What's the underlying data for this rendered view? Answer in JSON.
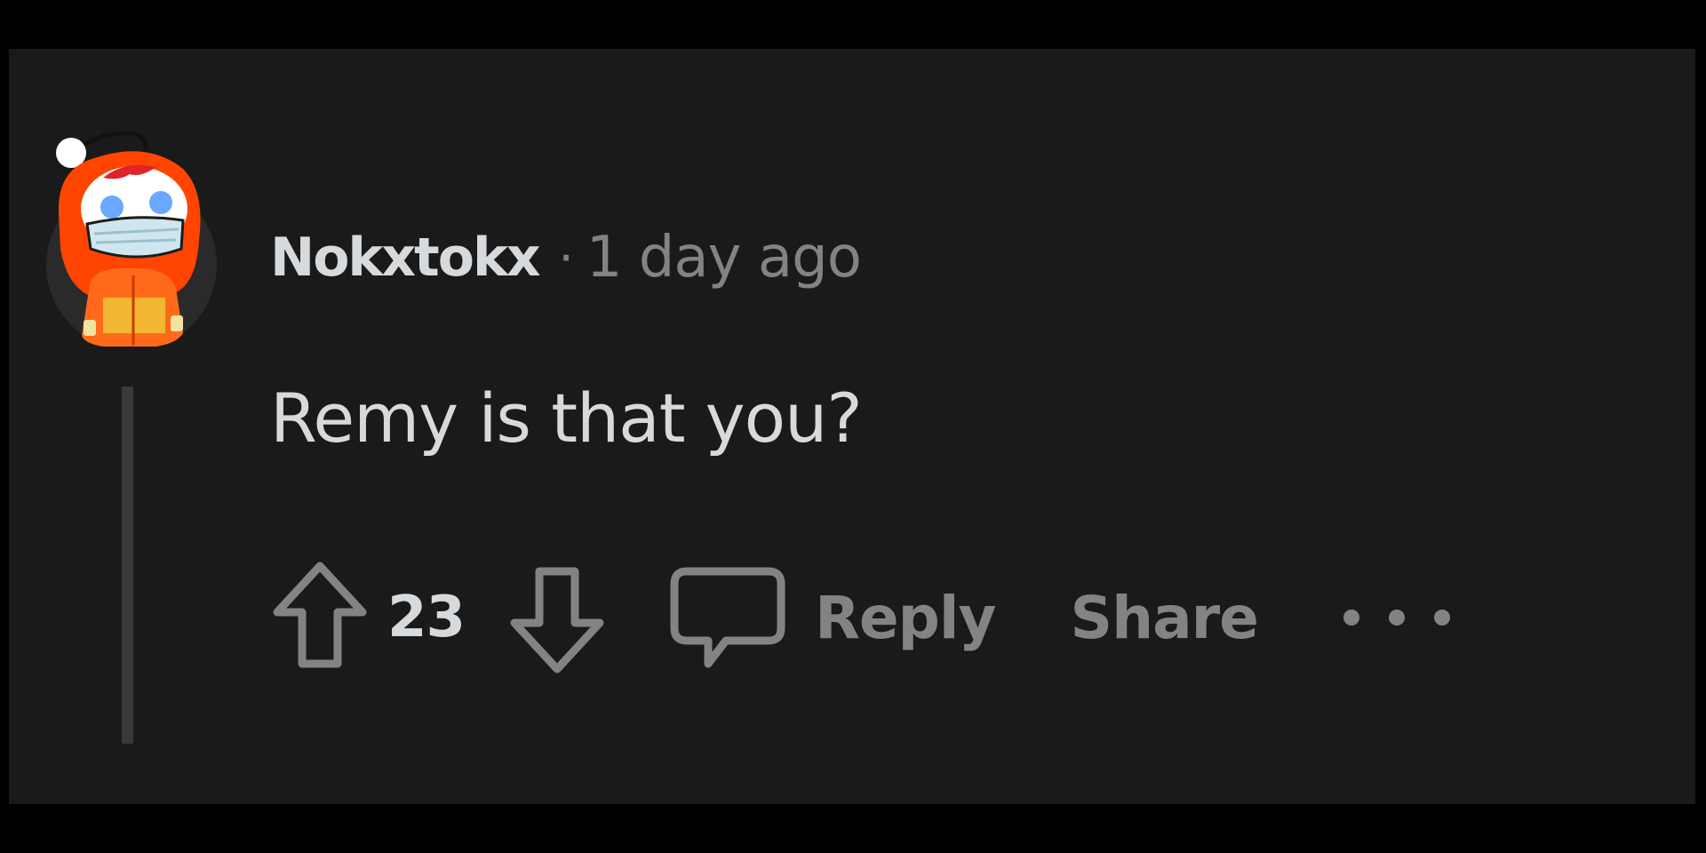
{
  "comment": {
    "username": "Nokxtokx",
    "separator": "·",
    "timestamp": "1 day ago",
    "body": "Remy is that you?",
    "score": "23"
  },
  "actions": {
    "reply_label": "Reply",
    "share_label": "Share",
    "more_icon": "more-horizontal-icon",
    "upvote_icon": "upvote-arrow-icon",
    "downvote_icon": "downvote-arrow-icon",
    "comment_icon": "speech-bubble-icon"
  },
  "colors": {
    "background": "#000000",
    "panel": "#1a1a1b",
    "primary_text": "#d7dadc",
    "secondary_text": "#818384",
    "avatar_hood": "#ff4500"
  }
}
